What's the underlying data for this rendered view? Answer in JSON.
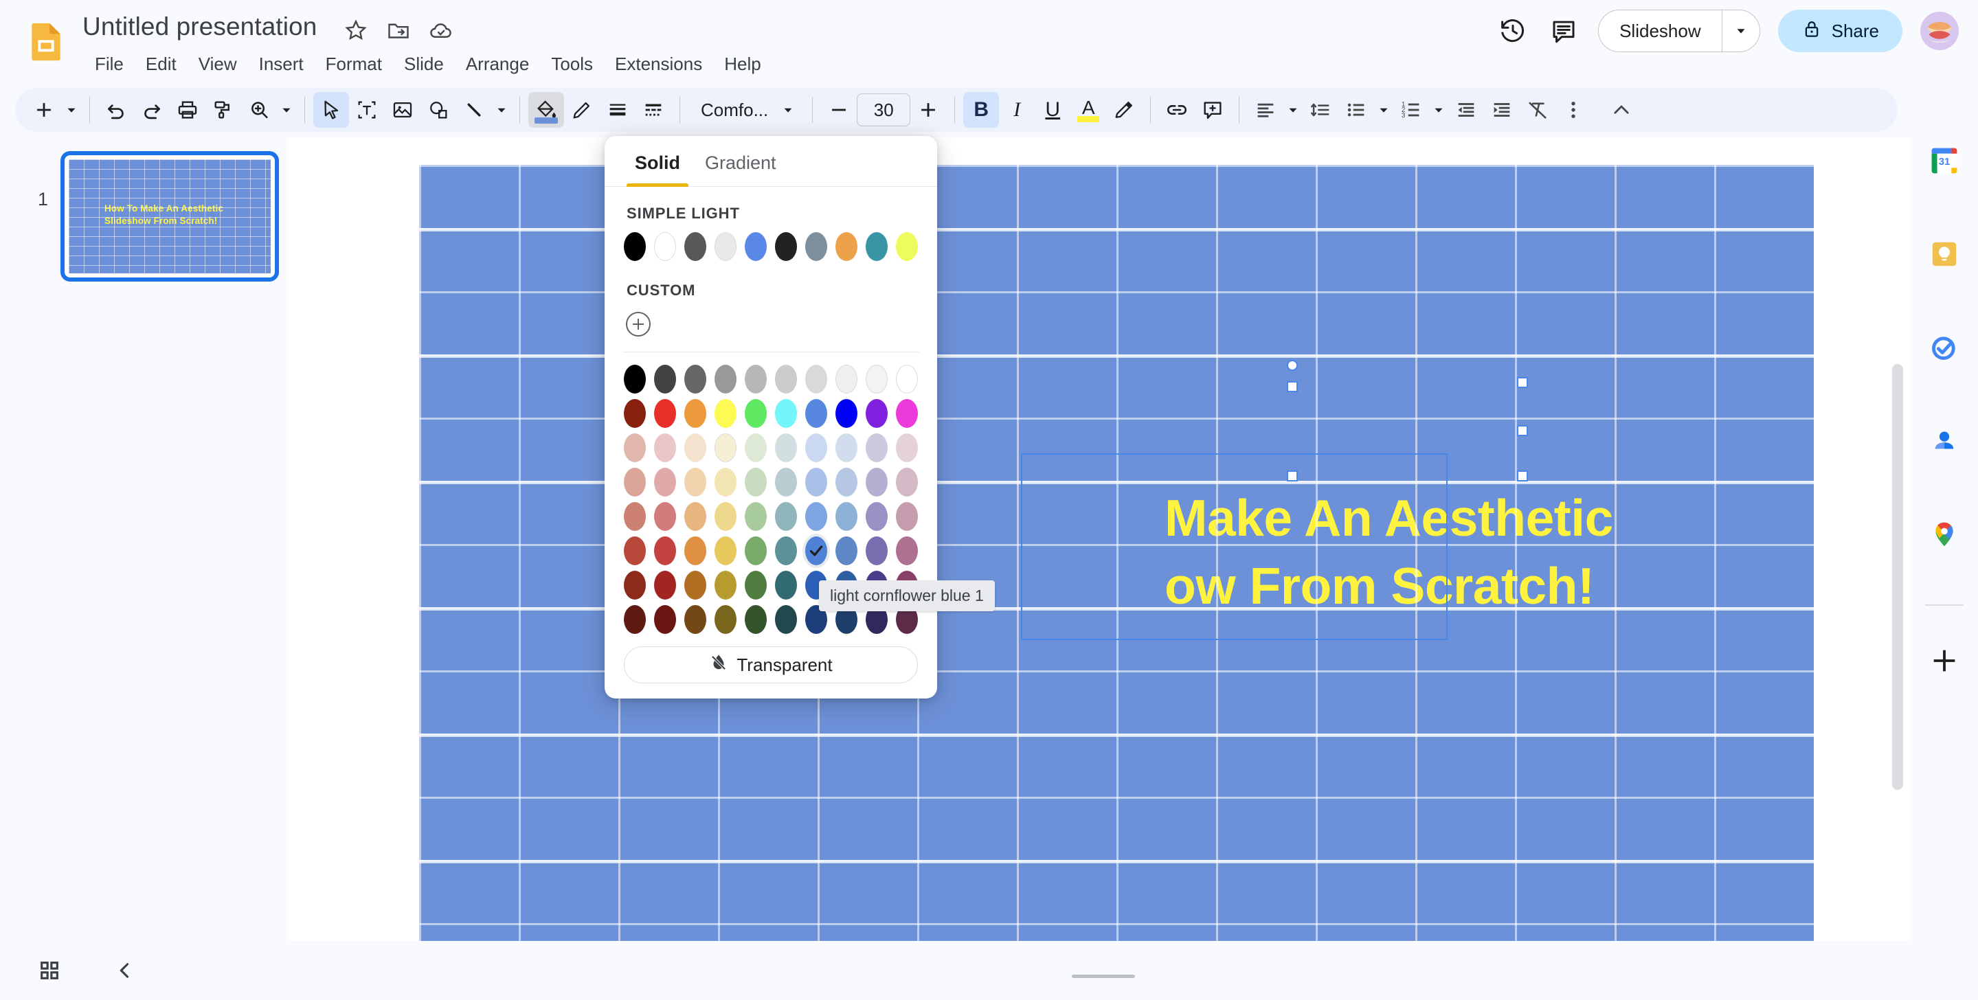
{
  "app": {
    "name": "Google Slides",
    "logo_icon": "slides-logo-icon"
  },
  "header": {
    "title": "Untitled presentation",
    "star_icon": "star-icon",
    "move_icon": "move-to-folder-icon",
    "cloud_icon": "cloud-saved-icon",
    "menus": [
      "File",
      "Edit",
      "View",
      "Insert",
      "Format",
      "Slide",
      "Arrange",
      "Tools",
      "Extensions",
      "Help"
    ],
    "history_icon": "version-history-icon",
    "comments_icon": "comment-history-icon",
    "slideshow_label": "Slideshow",
    "slideshow_caret_icon": "chevron-down-icon",
    "share_label": "Share",
    "share_lock_icon": "lock-icon",
    "avatar_icon": "user-avatar-icon",
    "share_bg": "#c2e7ff"
  },
  "toolbar": {
    "bg": "#edf2fc",
    "items": [
      {
        "name": "new-slide-button",
        "icon": "plus-icon"
      },
      {
        "name": "new-slide-caret",
        "icon": "chevron-down-icon"
      },
      {
        "name": "undo-button",
        "icon": "undo-icon"
      },
      {
        "name": "redo-button",
        "icon": "redo-icon"
      },
      {
        "name": "print-button",
        "icon": "print-icon"
      },
      {
        "name": "paint-format-button",
        "icon": "paint-roller-icon"
      },
      {
        "name": "zoom-button",
        "icon": "zoom-in-icon"
      },
      {
        "name": "zoom-caret",
        "icon": "chevron-down-icon"
      },
      {
        "name": "select-tool-button",
        "icon": "cursor-arrow-icon"
      },
      {
        "name": "text-box-button",
        "icon": "text-box-icon"
      },
      {
        "name": "insert-image-button",
        "icon": "image-icon"
      },
      {
        "name": "shape-button",
        "icon": "shape-icon"
      },
      {
        "name": "line-button",
        "icon": "line-icon"
      },
      {
        "name": "line-caret",
        "icon": "chevron-down-icon"
      },
      {
        "name": "fill-color-button",
        "icon": "fill-bucket-icon"
      },
      {
        "name": "border-color-button",
        "icon": "pencil-icon"
      },
      {
        "name": "border-weight-button",
        "icon": "border-weight-icon"
      },
      {
        "name": "border-dash-button",
        "icon": "border-dash-icon"
      }
    ],
    "font_family": "Comfo...",
    "font_size": "30",
    "font_size_decrease": "−",
    "font_size_increase": "+",
    "bold_label": "B",
    "italic_label": "I",
    "underline_label": "U",
    "text_color_label": "A",
    "text_color_value": "#fff33f",
    "fill_color_value": "#6d91d8",
    "highlight_icon": "highlight-pen-icon",
    "link_icon": "insert-link-icon",
    "comment_icon": "add-comment-icon",
    "align_icon": "align-left-icon",
    "line_spacing_icon": "line-spacing-icon",
    "bulleted_list_icon": "bulleted-list-icon",
    "numbered_list_icon": "numbered-list-icon",
    "decrease_indent_icon": "decrease-indent-icon",
    "increase_indent_icon": "increase-indent-icon",
    "clear_formatting_icon": "clear-formatting-icon",
    "more_options_icon": "more-vertical-icon",
    "collapse_icon": "chevron-up-icon"
  },
  "filmstrip": {
    "slides": [
      {
        "number": "1",
        "title_line1": "How To Make An Aesthetic",
        "title_line2": "Slideshow From Scratch!"
      }
    ]
  },
  "canvas": {
    "slide_bg": "#6d91d8",
    "title_line1": "Make An Aesthetic",
    "title_line2": "ow From Scratch!",
    "title_color": "#fff33f",
    "selected": true
  },
  "color_picker": {
    "tabs": [
      {
        "label": "Solid",
        "active": true
      },
      {
        "label": "Gradient",
        "active": false
      }
    ],
    "active_tab_underline": "#eab308",
    "theme_section_label": "SIMPLE LIGHT",
    "theme_colors": [
      "#000000",
      "#ffffff",
      "#585858",
      "#e9e9e9",
      "#5b87e8",
      "#222222",
      "#7d8f9c",
      "#eda14b",
      "#3795a4",
      "#eefb5c"
    ],
    "custom_section_label": "CUSTOM",
    "custom_add_icon": "add-custom-color-icon",
    "grid": [
      [
        "#000000",
        "#434343",
        "#666666",
        "#999999",
        "#b7b7b7",
        "#cccccc",
        "#d9d9d9",
        "#efefef",
        "#f3f3f3",
        "#ffffff"
      ],
      [
        "#88200e",
        "#e8302a",
        "#ed9a3c",
        "#fdfb53",
        "#5fe861",
        "#72f6f9",
        "#5786e0",
        "#0000f5",
        "#8021e0",
        "#ec3adb"
      ],
      [
        "#e2b8ae",
        "#e9c7c6",
        "#f4e3ce",
        "#f7efd4",
        "#dde8d5",
        "#d2dfe0",
        "#cbd8f1",
        "#d1dced",
        "#cfc9e0",
        "#e5d1da"
      ],
      [
        "#dba699",
        "#e0aaab",
        "#efd4ae",
        "#f3e6b4",
        "#c9dcc0",
        "#b9cdd0",
        "#a9c0e9",
        "#b5c7e2",
        "#b6afd2",
        "#d4b8c5"
      ],
      [
        "#cd8173",
        "#d37c7d",
        "#e8b581",
        "#eed88e",
        "#a8cb9c",
        "#8fb4ba",
        "#7ea5e2",
        "#8db0d6",
        "#9a90c4",
        "#c49cae"
      ],
      [
        "#b8493a",
        "#c3413f",
        "#df9040",
        "#e6c85d",
        "#79ab6a",
        "#5e929a",
        "#4f82d7",
        "#5e88c6",
        "#7a6db0",
        "#ae7190"
      ],
      [
        "#8e2a1c",
        "#a32522",
        "#b26e22",
        "#b89b2f",
        "#4f7d3f",
        "#336b73",
        "#2b5fb8",
        "#2e5ea0",
        "#4b3d8c",
        "#89406a"
      ],
      [
        "#5f1a11",
        "#6d1715",
        "#744816",
        "#79671d",
        "#33532a",
        "#22474c",
        "#1c3f7b",
        "#1f3f6b",
        "#31285d",
        "#5c2b47"
      ]
    ],
    "selected_row": 5,
    "selected_col": 6,
    "selected_check_icon": "checkmark-icon",
    "transparent_label": "Transparent",
    "transparent_icon": "transparent-drop-icon",
    "tooltip": "light cornflower blue 1"
  },
  "sidepanel": {
    "items": [
      {
        "name": "google-calendar-icon",
        "label": "Calendar",
        "day": "31"
      },
      {
        "name": "google-keep-icon",
        "label": "Keep"
      },
      {
        "name": "google-tasks-icon",
        "label": "Tasks"
      },
      {
        "name": "google-contacts-icon",
        "label": "Contacts"
      },
      {
        "name": "google-maps-icon",
        "label": "Maps"
      },
      {
        "name": "add-addon-icon",
        "label": "Get add-ons"
      }
    ]
  },
  "bottombar": {
    "grid_view_icon": "grid-view-icon",
    "collapse_filmstrip_icon": "chevron-left-icon"
  }
}
